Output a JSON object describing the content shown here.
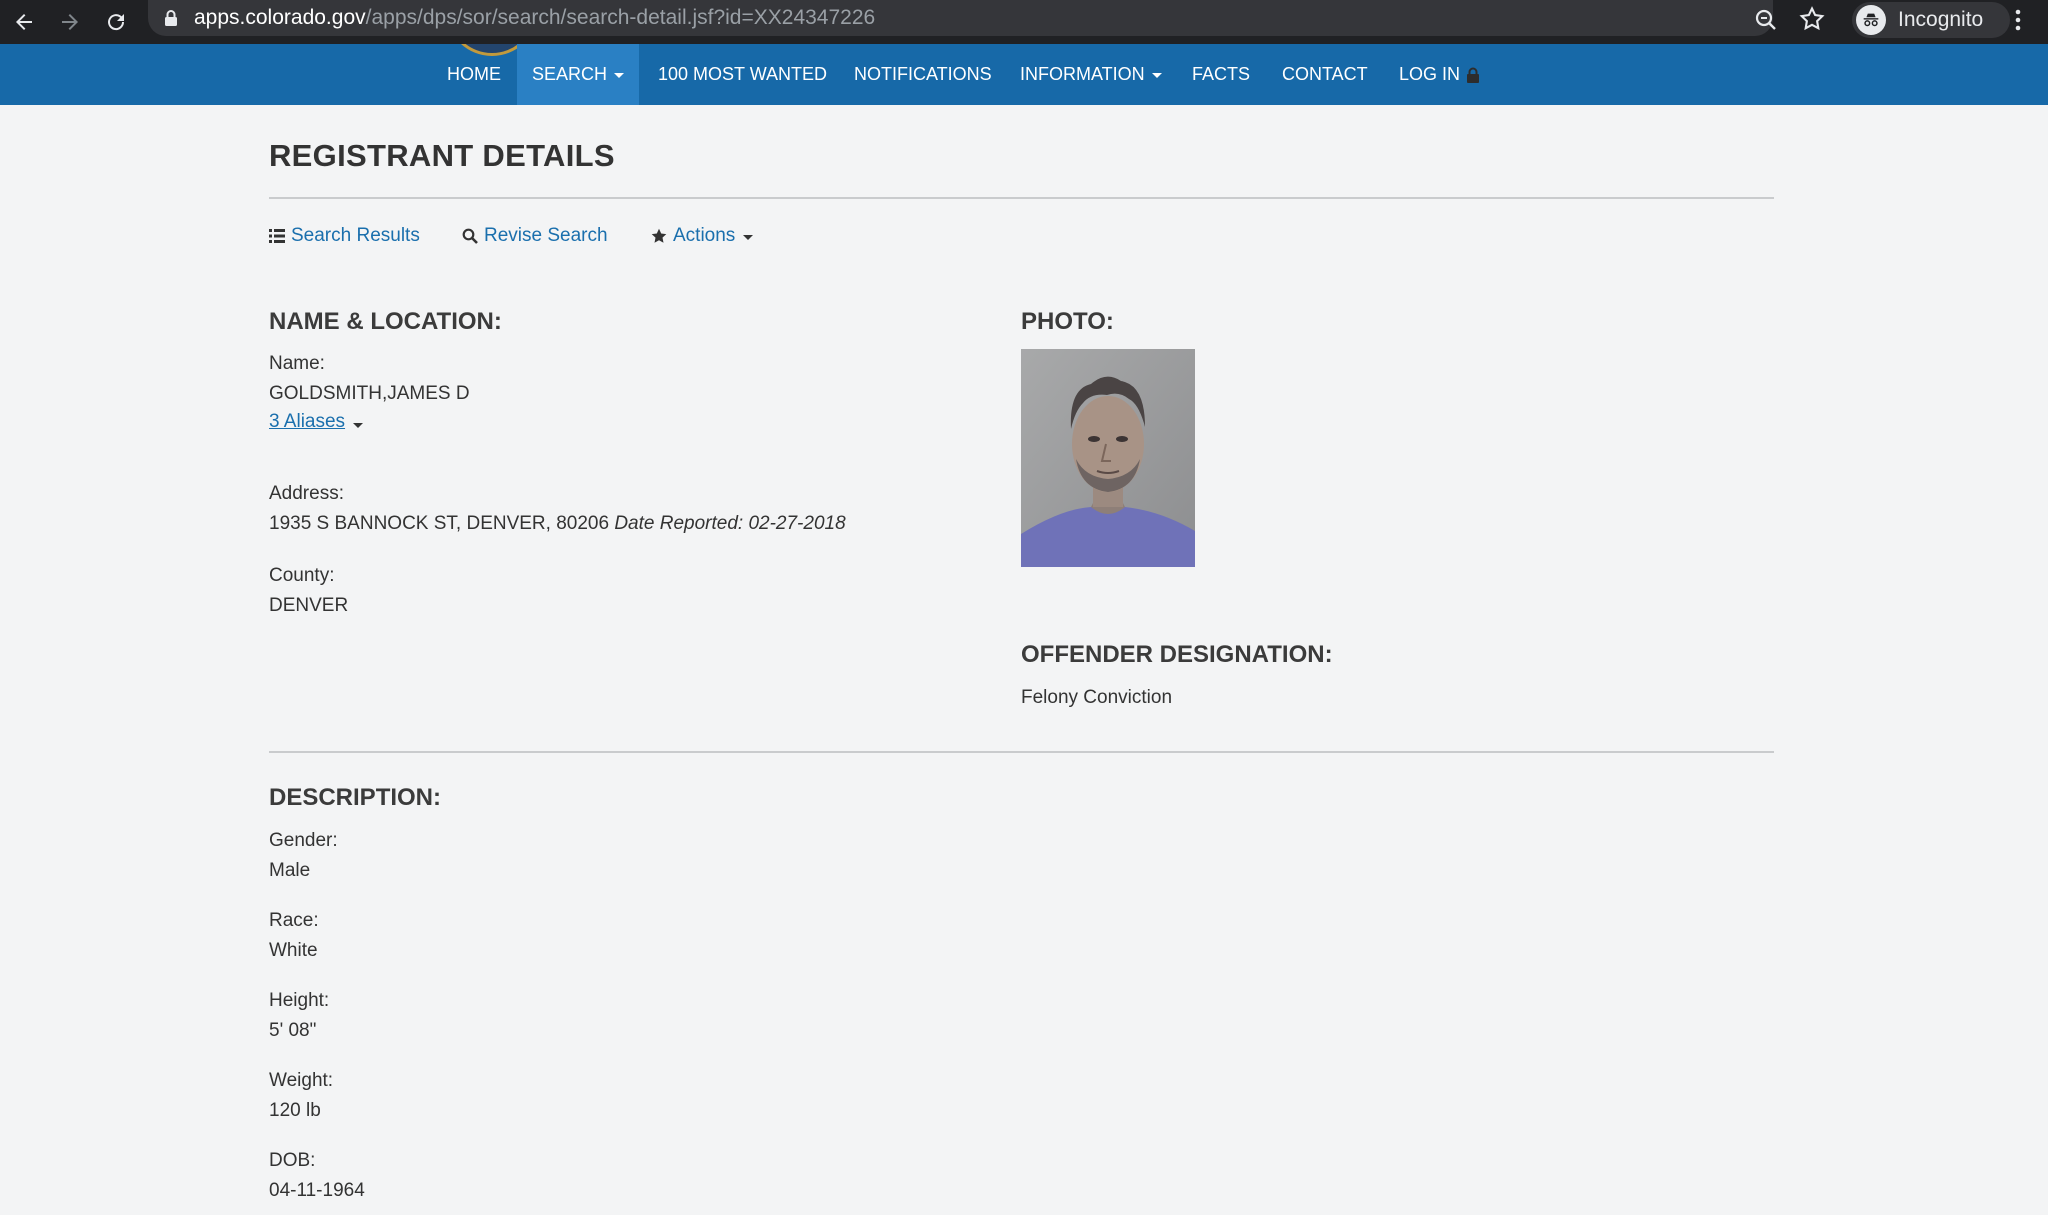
{
  "browser": {
    "url_host": "apps.colorado.gov",
    "url_path": "/apps/dps/sor/search/search-detail.jsf?id=XX24347226",
    "incognito_label": "Incognito"
  },
  "navbar": {
    "items": [
      {
        "label": "HOME"
      },
      {
        "label": "SEARCH"
      },
      {
        "label": "100 MOST WANTED"
      },
      {
        "label": "NOTIFICATIONS"
      },
      {
        "label": "INFORMATION"
      },
      {
        "label": "FACTS"
      },
      {
        "label": "CONTACT"
      },
      {
        "label": "LOG IN"
      }
    ]
  },
  "page": {
    "title": "REGISTRANT DETAILS",
    "links": {
      "search_results": "Search Results",
      "revise_search": "Revise Search",
      "actions": "Actions"
    }
  },
  "name_location": {
    "heading": "NAME & LOCATION:",
    "name_label": "Name:",
    "name_value": "GOLDSMITH,JAMES D",
    "aliases_link": "3 Aliases",
    "address_label": "Address:",
    "address_value": "1935 S BANNOCK ST, DENVER, 80206",
    "date_reported": "Date Reported: 02-27-2018",
    "county_label": "County:",
    "county_value": "DENVER"
  },
  "photo": {
    "heading": "PHOTO:"
  },
  "designation": {
    "heading": "OFFENDER DESIGNATION:",
    "value": "Felony Conviction"
  },
  "description": {
    "heading": "DESCRIPTION:",
    "fields": [
      {
        "label": "Gender:",
        "value": "Male"
      },
      {
        "label": "Race:",
        "value": "White"
      },
      {
        "label": "Height:",
        "value": "5' 08\""
      },
      {
        "label": "Weight:",
        "value": "120 lb"
      },
      {
        "label": "DOB:",
        "value": "04-11-1964"
      }
    ]
  }
}
